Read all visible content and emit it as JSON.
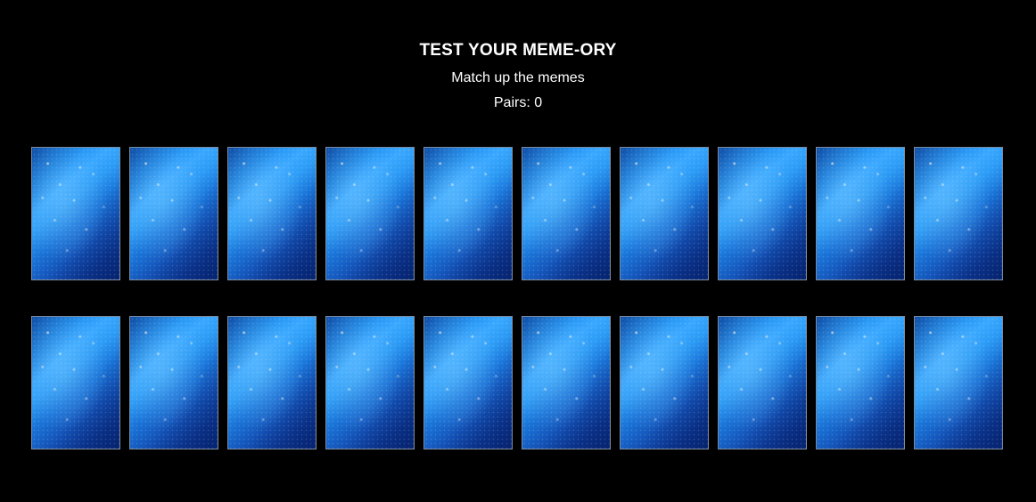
{
  "header": {
    "title": "TEST YOUR MEME-ORY",
    "subtitle": "Match up the memes",
    "pairs_label": "Pairs: ",
    "pairs_count": "0"
  },
  "board": {
    "card_back": "blue-glitter-card-back",
    "card_count": 20,
    "rows": 2,
    "columns": 10
  },
  "colors": {
    "background": "#000000",
    "text": "#ffffff",
    "card_border": "#7a8aa0",
    "card_highlight": "#3aa8ff",
    "card_shadow": "#0a2f80"
  }
}
